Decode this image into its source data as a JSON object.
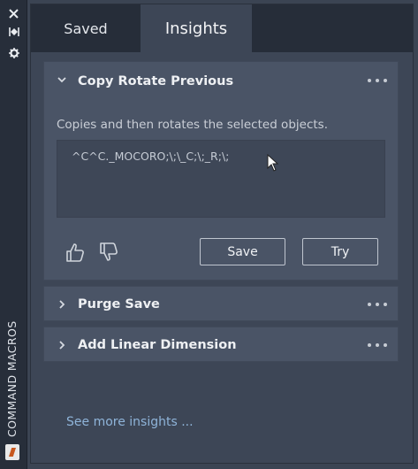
{
  "strip": {
    "title": "COMMAND MACROS",
    "close_icon": "close-icon",
    "dock_icon": "dock-icon",
    "settings_icon": "gear-icon"
  },
  "tabs": [
    {
      "label": "Saved",
      "active": false
    },
    {
      "label": "Insights",
      "active": true
    }
  ],
  "cards": {
    "expanded": {
      "title": "Copy Rotate Previous",
      "description": "Copies and then rotates the selected objects.",
      "macro": "^C^C._MOCORO;\\;\\_C;\\;_R;\\;",
      "save_label": "Save",
      "try_label": "Try"
    },
    "collapsed": [
      {
        "title": "Purge Save"
      },
      {
        "title": "Add Linear Dimension"
      }
    ]
  },
  "footer": {
    "see_more": "See more insights ..."
  },
  "colors": {
    "accent_link": "#8fb4d9",
    "panel_bg": "#3d4656",
    "card_bg": "#4a5466",
    "tab_bar_bg": "#262d39"
  }
}
